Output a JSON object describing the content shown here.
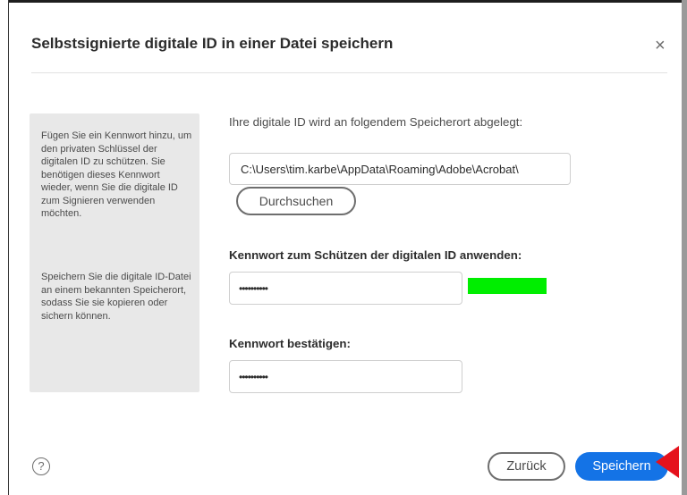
{
  "dialog": {
    "title": "Selbstsignierte digitale ID in einer Datei speichern",
    "close_glyph": "×"
  },
  "info": {
    "paragraph1": "Fügen Sie ein Kennwort hinzu, um den privaten Schlüssel der digitalen ID zu schützen. Sie benötigen dieses Kennwort wieder, wenn Sie die digitale ID zum Signieren verwenden möchten.",
    "paragraph2": "Speichern Sie die digitale ID-Datei an einem bekannten Speicherort, sodass Sie sie kopieren oder sichern können."
  },
  "location": {
    "label": "Ihre digitale ID wird an folgendem Speicherort abgelegt:",
    "path": "C:\\Users\\tim.karbe\\AppData\\Roaming\\Adobe\\Acrobat\\",
    "browse_label": "Durchsuchen"
  },
  "password": {
    "label": "Kennwort zum Schützen der digitalen ID anwenden:",
    "value": "••••••••••",
    "strength_color": "#00ee00"
  },
  "confirm": {
    "label": "Kennwort bestätigen:",
    "value": "••••••••••"
  },
  "footer": {
    "help_glyph": "?",
    "back_label": "Zurück",
    "save_label": "Speichern",
    "accent_color": "#1473e6",
    "annotation_arrow_color": "#e5121c"
  }
}
